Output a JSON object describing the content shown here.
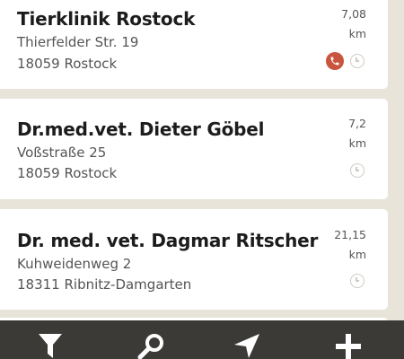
{
  "clinics": [
    {
      "name": "Tierklinik Rostock",
      "street": "Thierfelder Str. 19",
      "city": "18059 Rostock",
      "distance_value": "7,08",
      "distance_unit": "km",
      "has_phone": true
    },
    {
      "name": "Dr.med.vet. Dieter Göbel",
      "street": "Voßstraße 25",
      "city": "18059 Rostock",
      "distance_value": "7,2",
      "distance_unit": "km",
      "has_phone": false
    },
    {
      "name": "Dr. med. vet. Dagmar Ritscher",
      "street": "Kuhweidenweg 2",
      "city": "18311 Ribnitz-Damgarten",
      "distance_value": "21,15",
      "distance_unit": "km",
      "has_phone": false
    }
  ],
  "toolbar": {
    "items": [
      "filter-icon",
      "search-icon",
      "location-arrow-icon",
      "add-icon"
    ]
  },
  "colors": {
    "background": "#e8e4da",
    "card": "#ffffff",
    "toolbar": "#3b3a37",
    "phone_accent": "#c9553e",
    "clock_icon": "#cfcbc1"
  }
}
